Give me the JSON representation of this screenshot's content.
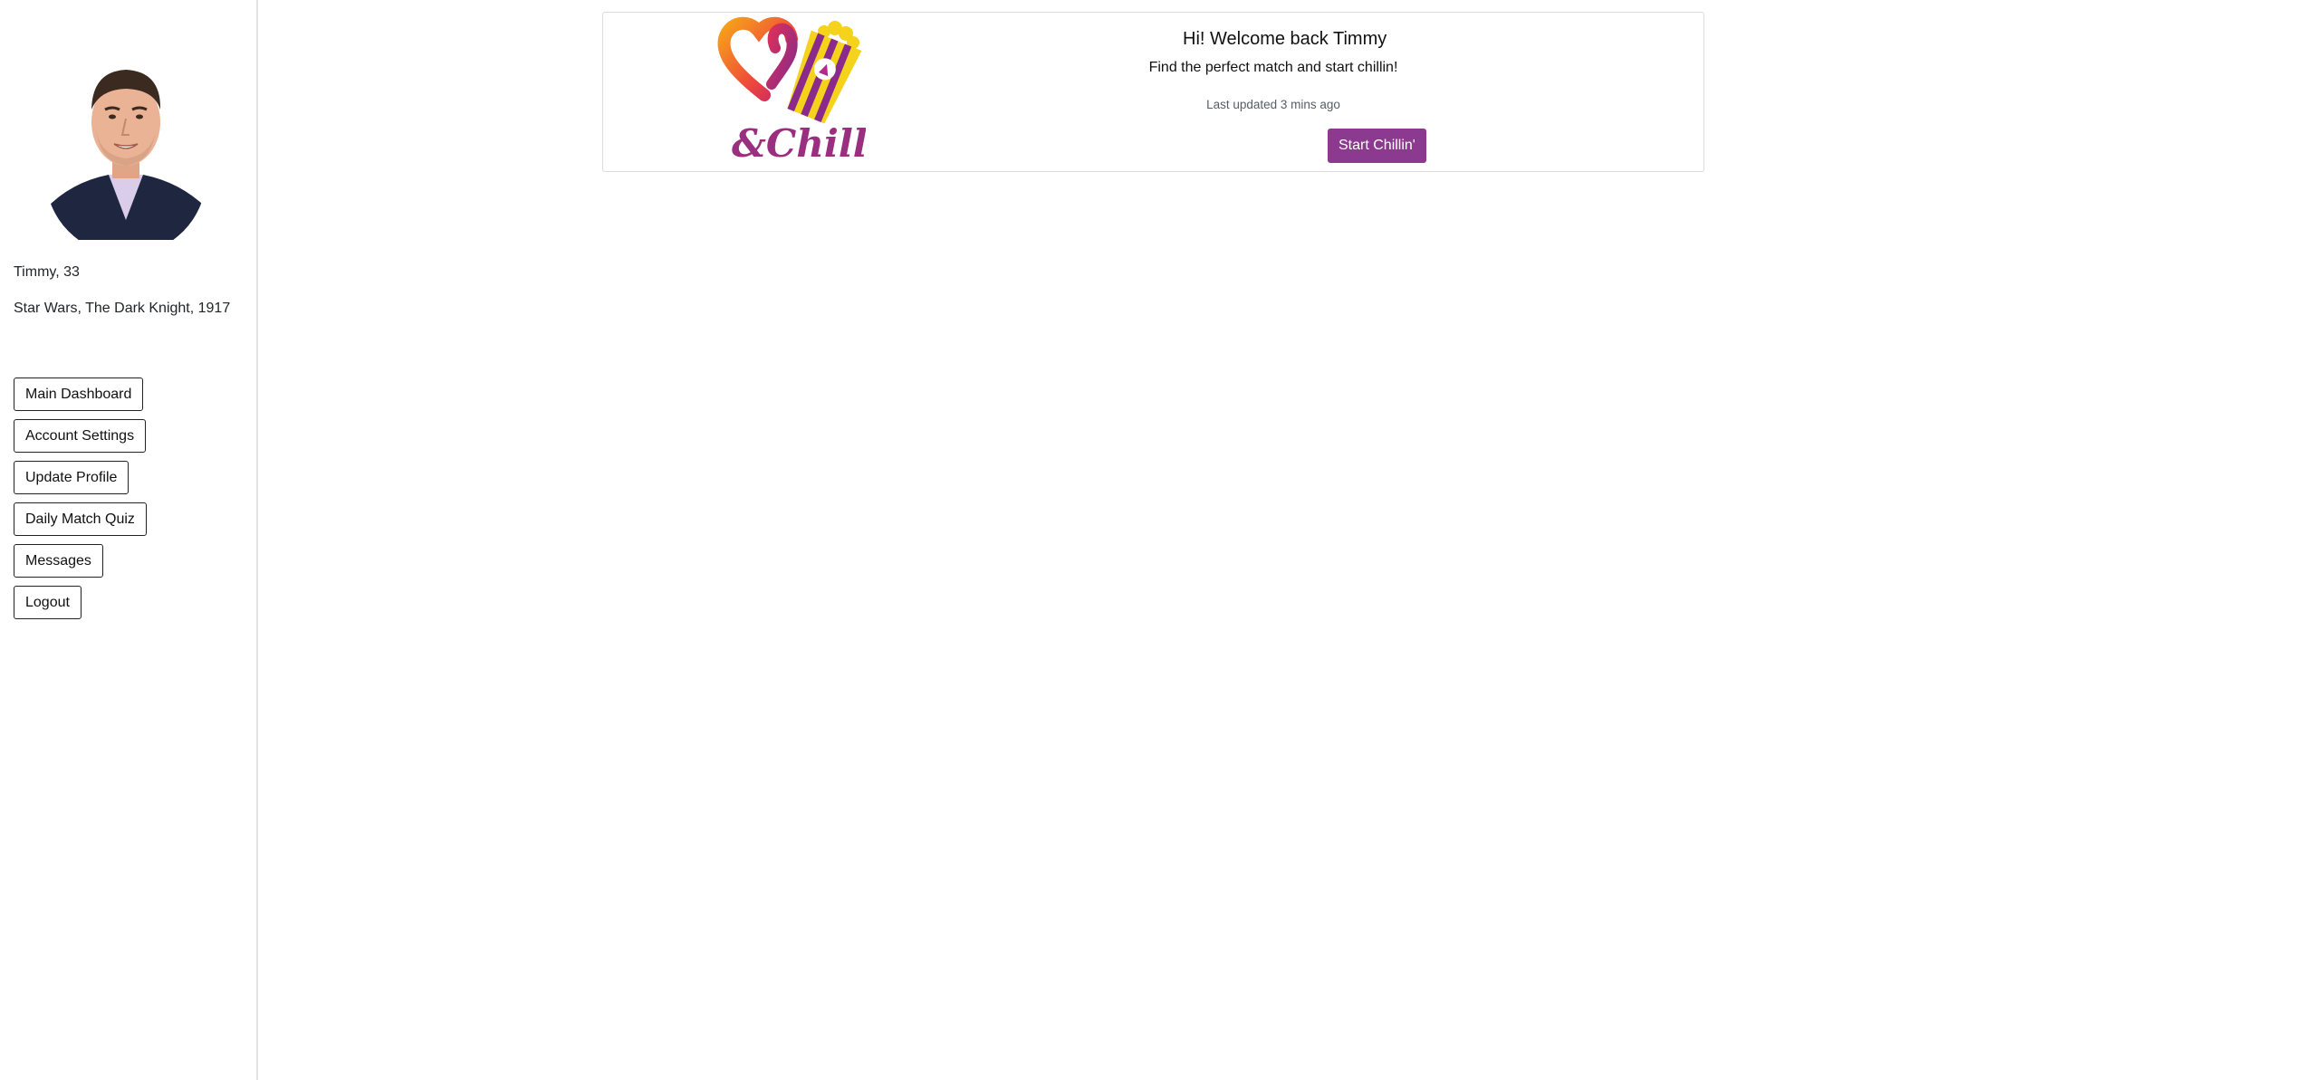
{
  "sidebar": {
    "avatar_alt": "Profile photo",
    "profile_name": "Timmy, 33",
    "favorite_movies": "Star Wars, The Dark Knight, 1917",
    "nav": [
      {
        "label": "Main Dashboard"
      },
      {
        "label": "Account Settings"
      },
      {
        "label": "Update Profile"
      },
      {
        "label": "Daily Match Quiz"
      },
      {
        "label": "Messages"
      },
      {
        "label": "Logout"
      }
    ]
  },
  "welcome_card": {
    "logo_text": "&Chill",
    "title": "Hi! Welcome back Timmy",
    "subtitle": "Find the perfect match and start chillin!",
    "last_updated": "Last updated 3 mins ago",
    "cta_label": "Start Chillin'"
  },
  "colors": {
    "brand_purple": "#8b3a8f",
    "logo_orange": "#f39a1b",
    "logo_yellow": "#f5d21b",
    "logo_magenta": "#b5288c",
    "sidebar_divider": "#e3e3e3"
  }
}
